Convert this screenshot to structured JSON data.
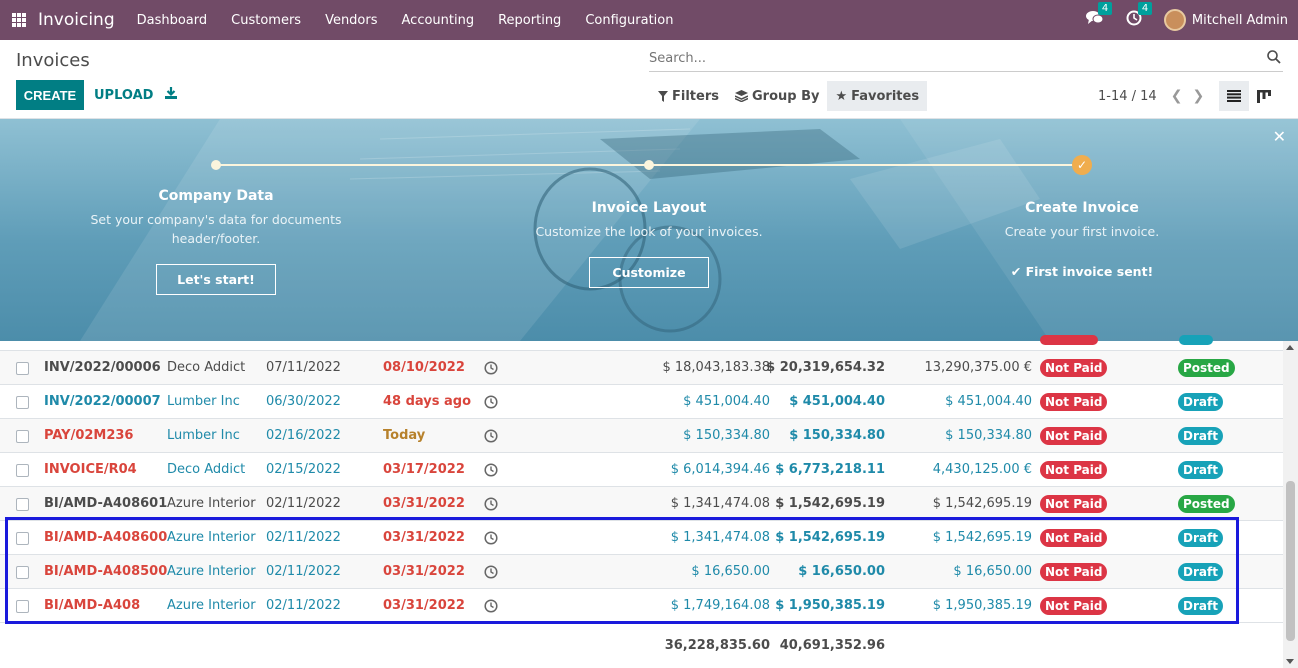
{
  "navbar": {
    "app_name": "Invoicing",
    "menu": [
      "Dashboard",
      "Customers",
      "Vendors",
      "Accounting",
      "Reporting",
      "Configuration"
    ],
    "messages_count": "4",
    "activities_count": "4",
    "user_name": "Mitchell Admin"
  },
  "control": {
    "title": "Invoices",
    "create_label": "CREATE",
    "upload_label": "UPLOAD",
    "search_placeholder": "Search...",
    "filters_label": "Filters",
    "groupby_label": "Group By",
    "favorites_label": "Favorites",
    "pager": "1-14 / 14"
  },
  "banner": {
    "steps": [
      {
        "title": "Company Data",
        "desc": "Set your company's data for documents header/footer.",
        "button": "Let's start!"
      },
      {
        "title": "Invoice Layout",
        "desc": "Customize the look of your invoices.",
        "button": "Customize"
      },
      {
        "title": "Create Invoice",
        "desc": "Create your first invoice.",
        "done": "First invoice sent!"
      }
    ]
  },
  "colors": {
    "brand": "#714b67",
    "primary": "#017e84",
    "link": "#1f8aa9",
    "danger": "#d9453c",
    "warning": "#b7812b",
    "not_paid": "#dc3545",
    "posted": "#28a745",
    "draft": "#17a2b8"
  },
  "rows": [
    {
      "number": "INV/2022/00006",
      "number_style": "dark",
      "partner": "Deco Addict",
      "inv_date": "07/11/2022",
      "due": "08/10/2022",
      "due_style": "danger",
      "untaxed": "$ 18,043,183.38",
      "total": "$ 20,319,654.32",
      "signed": "13,290,375.00 €",
      "text_style": "dark",
      "payment": "Not Paid",
      "status": "Posted"
    },
    {
      "number": "INV/2022/00007",
      "number_style": "link",
      "partner": "Lumber Inc",
      "inv_date": "06/30/2022",
      "due": "48 days ago",
      "due_style": "danger",
      "untaxed": "$ 451,004.40",
      "total": "$ 451,004.40",
      "signed": "$ 451,004.40",
      "text_style": "link",
      "payment": "Not Paid",
      "status": "Draft"
    },
    {
      "number": "PAY/02M236",
      "number_style": "danger",
      "partner": "Lumber Inc",
      "inv_date": "02/16/2022",
      "due": "Today",
      "due_style": "warning",
      "untaxed": "$ 150,334.80",
      "total": "$ 150,334.80",
      "signed": "$ 150,334.80",
      "text_style": "link",
      "payment": "Not Paid",
      "status": "Draft"
    },
    {
      "number": "INVOICE/R04",
      "number_style": "danger",
      "partner": "Deco Addict",
      "inv_date": "02/15/2022",
      "due": "03/17/2022",
      "due_style": "danger",
      "untaxed": "$ 6,014,394.46",
      "total": "$ 6,773,218.11",
      "signed": "4,430,125.00 €",
      "text_style": "link",
      "payment": "Not Paid",
      "status": "Draft"
    },
    {
      "number": "BI/AMD-A408601",
      "number_style": "dark",
      "partner": "Azure Interior",
      "inv_date": "02/11/2022",
      "due": "03/31/2022",
      "due_style": "danger",
      "untaxed": "$ 1,341,474.08",
      "total": "$ 1,542,695.19",
      "signed": "$ 1,542,695.19",
      "text_style": "dark",
      "payment": "Not Paid",
      "status": "Posted"
    },
    {
      "number": "BI/AMD-A408600",
      "number_style": "danger",
      "partner": "Azure Interior",
      "inv_date": "02/11/2022",
      "due": "03/31/2022",
      "due_style": "danger",
      "untaxed": "$ 1,341,474.08",
      "total": "$ 1,542,695.19",
      "signed": "$ 1,542,695.19",
      "text_style": "link",
      "payment": "Not Paid",
      "status": "Draft"
    },
    {
      "number": "BI/AMD-A408500",
      "number_style": "danger",
      "partner": "Azure Interior",
      "inv_date": "02/11/2022",
      "due": "03/31/2022",
      "due_style": "danger",
      "untaxed": "$ 16,650.00",
      "total": "$ 16,650.00",
      "signed": "$ 16,650.00",
      "text_style": "link",
      "payment": "Not Paid",
      "status": "Draft"
    },
    {
      "number": "BI/AMD-A408",
      "number_style": "danger",
      "partner": "Azure Interior",
      "inv_date": "02/11/2022",
      "due": "03/31/2022",
      "due_style": "danger",
      "untaxed": "$ 1,749,164.08",
      "total": "$ 1,950,385.19",
      "signed": "$ 1,950,385.19",
      "text_style": "link",
      "payment": "Not Paid",
      "status": "Draft"
    }
  ],
  "totals": {
    "untaxed": "36,228,835.60",
    "total": "40,691,352.96"
  }
}
